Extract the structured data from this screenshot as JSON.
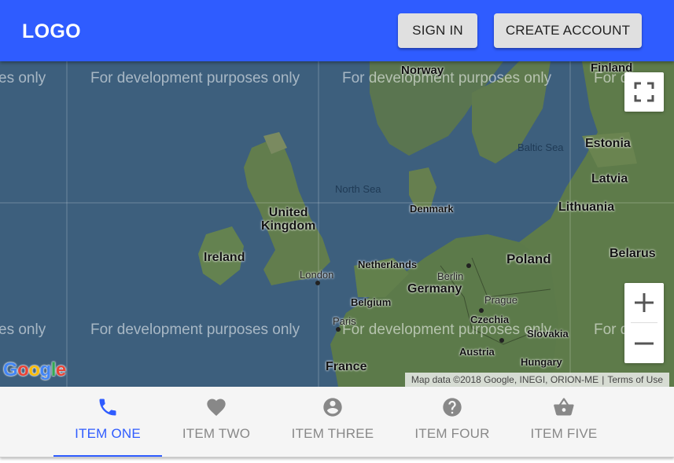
{
  "header": {
    "logo": "LOGO",
    "sign_in": "SIGN IN",
    "create_account": "CREATE ACCOUNT"
  },
  "map": {
    "watermark": "For development purposes only",
    "watermark_partial": "es only",
    "watermark_partial_right": "For d",
    "labels": {
      "norway": "Norway",
      "finland": "Finland",
      "estonia": "Estonia",
      "latvia": "Latvia",
      "lithuania": "Lithuania",
      "baltic_sea": "Baltic Sea",
      "north_sea": "North Sea",
      "denmark": "Denmark",
      "united_kingdom": "United\nKingdom",
      "ireland": "Ireland",
      "london": "London",
      "netherlands": "Netherlands",
      "berlin": "Berlin",
      "poland": "Poland",
      "belarus": "Belarus",
      "germany": "Germany",
      "belgium": "Belgium",
      "prague": "Prague",
      "paris": "Paris",
      "czechia": "Czechia",
      "slovakia": "Slovakia",
      "austria": "Austria",
      "france": "France",
      "hungary": "Hungary"
    },
    "attribution": "Map data ©2018 Google, INEGI, ORION-ME",
    "terms": "Terms of Use",
    "google_logo": "Google"
  },
  "nav": {
    "items": [
      {
        "label": "ITEM ONE",
        "icon": "phone-icon",
        "active": true
      },
      {
        "label": "ITEM TWO",
        "icon": "heart-icon",
        "active": false
      },
      {
        "label": "ITEM THREE",
        "icon": "account-circle-icon",
        "active": false
      },
      {
        "label": "ITEM FOUR",
        "icon": "help-icon",
        "active": false
      },
      {
        "label": "ITEM FIVE",
        "icon": "shopping-basket-icon",
        "active": false
      }
    ]
  },
  "colors": {
    "primary": "#2f5cff",
    "nav_inactive": "#888888",
    "water": "#3d5f7d",
    "land": "#5c7a4a"
  }
}
